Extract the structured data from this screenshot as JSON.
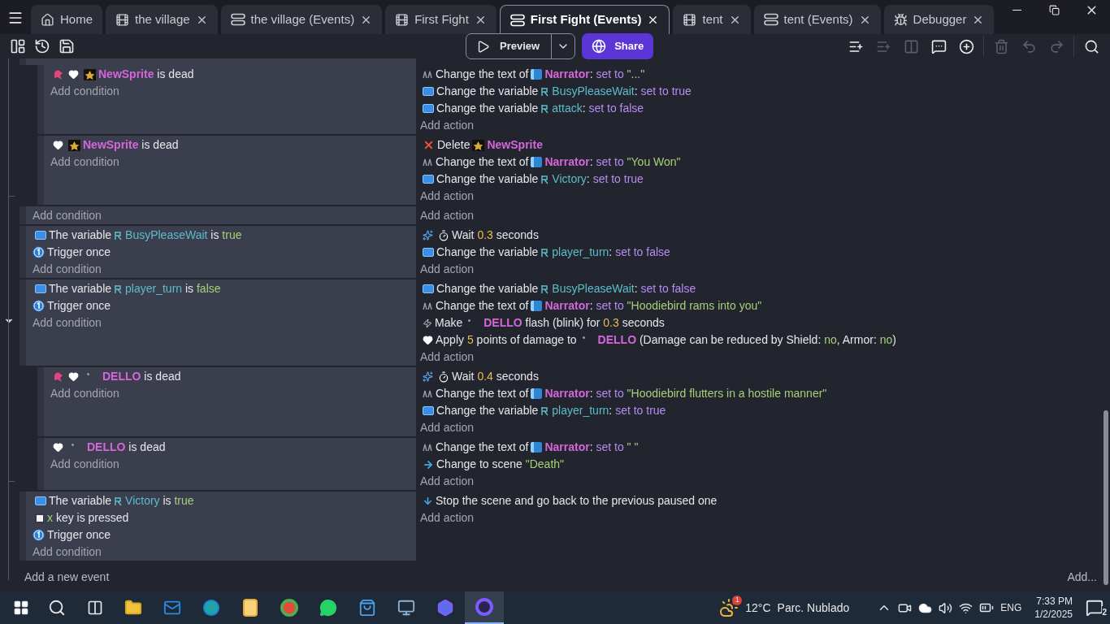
{
  "tabs": [
    {
      "label": "Home",
      "kind": "home",
      "closable": false,
      "selected": false
    },
    {
      "label": "the village",
      "kind": "scene",
      "closable": true,
      "selected": false
    },
    {
      "label": "the village (Events)",
      "kind": "events",
      "closable": true,
      "selected": false
    },
    {
      "label": "First Fight",
      "kind": "scene",
      "closable": true,
      "selected": false
    },
    {
      "label": "First Fight (Events)",
      "kind": "events",
      "closable": true,
      "selected": true
    },
    {
      "label": "tent",
      "kind": "scene",
      "closable": true,
      "selected": false
    },
    {
      "label": "tent (Events)",
      "kind": "events",
      "closable": true,
      "selected": false
    },
    {
      "label": "Debugger",
      "kind": "debugger",
      "closable": true,
      "selected": false
    }
  ],
  "toolbar": {
    "preview": "Preview",
    "share": "Share",
    "tools": [
      {
        "kind": "addevent",
        "disabled": false
      },
      {
        "kind": "addsub",
        "disabled": true
      },
      {
        "kind": "addelse",
        "disabled": true
      },
      {
        "kind": "comment",
        "disabled": false
      },
      {
        "kind": "add",
        "disabled": false
      },
      {
        "kind": "delete",
        "disabled": true
      },
      {
        "kind": "undo",
        "disabled": true
      },
      {
        "kind": "redo",
        "disabled": true
      },
      {
        "kind": "search",
        "disabled": false
      }
    ]
  },
  "events": [
    {
      "clipped": true,
      "hovered": false,
      "children": [
        {
          "clipped": false,
          "hovered": false,
          "add_condition": "Add condition",
          "add_action": "Add action",
          "conditions": [
            [
              {
                "kind": "potion"
              },
              {
                "kind": "heart"
              },
              {
                "kind": "sprite"
              },
              {
                "text": "NewSprite",
                "kind": "object"
              },
              {
                "text": " is dead",
                "kind": "plain"
              }
            ]
          ],
          "actions": [
            [
              {
                "kind": "textaction"
              },
              {
                "text": "Change the text of",
                "kind": "plain"
              },
              {
                "kind": "textobj"
              },
              {
                "text": "Narrator",
                "kind": "object"
              },
              {
                "text": ": ",
                "kind": "plain"
              },
              {
                "text": "set to ",
                "kind": "value"
              },
              {
                "text": "\"...\"",
                "kind": "string"
              }
            ],
            [
              {
                "kind": "var"
              },
              {
                "text": "Change the variable",
                "kind": "plain"
              },
              {
                "kind": "varref"
              },
              {
                "text": "BusyPleaseWait",
                "kind": "variable"
              },
              {
                "text": ": ",
                "kind": "plain"
              },
              {
                "text": "set to true",
                "kind": "value"
              }
            ],
            [
              {
                "kind": "var"
              },
              {
                "text": "Change the variable",
                "kind": "plain"
              },
              {
                "kind": "varref"
              },
              {
                "text": "attack",
                "kind": "variable"
              },
              {
                "text": ": ",
                "kind": "plain"
              },
              {
                "text": "set to false",
                "kind": "value"
              }
            ]
          ]
        },
        {
          "clipped": false,
          "hovered": false,
          "add_condition": "Add condition",
          "add_action": "Add action",
          "conditions": [
            [
              {
                "kind": "heart"
              },
              {
                "kind": "sprite"
              },
              {
                "text": "NewSprite",
                "kind": "object"
              },
              {
                "text": " is dead",
                "kind": "plain"
              }
            ]
          ],
          "actions": [
            [
              {
                "kind": "delete"
              },
              {
                "text": "Delete",
                "kind": "plain"
              },
              {
                "kind": "sprite"
              },
              {
                "text": "NewSprite",
                "kind": "object"
              }
            ],
            [
              {
                "kind": "textaction"
              },
              {
                "text": "Change the text of",
                "kind": "plain"
              },
              {
                "kind": "textobj"
              },
              {
                "text": "Narrator",
                "kind": "object"
              },
              {
                "text": ": ",
                "kind": "plain"
              },
              {
                "text": "set to ",
                "kind": "value"
              },
              {
                "text": "\"You Won\"",
                "kind": "string"
              }
            ],
            [
              {
                "kind": "var"
              },
              {
                "text": "Change the variable",
                "kind": "plain"
              },
              {
                "kind": "varref"
              },
              {
                "text": "Victory",
                "kind": "variable"
              },
              {
                "text": ": ",
                "kind": "plain"
              },
              {
                "text": "set to true",
                "kind": "value"
              }
            ]
          ]
        }
      ]
    },
    {
      "clipped": false,
      "hovered": false,
      "add_condition": "Add condition",
      "add_action": "Add action"
    },
    {
      "clipped": false,
      "hovered": false,
      "add_condition": "Add condition",
      "add_action": "Add action",
      "conditions": [
        [
          {
            "kind": "var"
          },
          {
            "text": "The variable",
            "kind": "plain"
          },
          {
            "kind": "varref"
          },
          {
            "text": "BusyPleaseWait",
            "kind": "variable"
          },
          {
            "text": " is ",
            "kind": "plain"
          },
          {
            "text": "true",
            "kind": "bool"
          }
        ],
        [
          {
            "kind": "trigger"
          },
          {
            "text": "Trigger once",
            "kind": "plain"
          }
        ]
      ],
      "actions": [
        [
          {
            "kind": "wait"
          },
          {
            "kind": "timer"
          },
          {
            "text": "Wait ",
            "kind": "plain"
          },
          {
            "text": "0.3",
            "kind": "number"
          },
          {
            "text": " seconds",
            "kind": "plain"
          }
        ],
        [
          {
            "kind": "var"
          },
          {
            "text": "Change the variable",
            "kind": "plain"
          },
          {
            "kind": "varref"
          },
          {
            "text": "player_turn",
            "kind": "variable"
          },
          {
            "text": ": ",
            "kind": "plain"
          },
          {
            "text": "set to false",
            "kind": "value"
          }
        ]
      ]
    },
    {
      "clipped": false,
      "hovered": true,
      "add_condition": "Add condition",
      "add_action": "Add action",
      "conditions": [
        [
          {
            "kind": "var"
          },
          {
            "text": "The variable",
            "kind": "plain"
          },
          {
            "kind": "varref"
          },
          {
            "text": "player_turn",
            "kind": "variable"
          },
          {
            "text": " is ",
            "kind": "plain"
          },
          {
            "text": "false",
            "kind": "bool"
          }
        ],
        [
          {
            "kind": "trigger"
          },
          {
            "text": "Trigger once",
            "kind": "plain"
          }
        ]
      ],
      "actions": [
        [
          {
            "kind": "var"
          },
          {
            "text": "Change the variable",
            "kind": "plain"
          },
          {
            "kind": "varref"
          },
          {
            "text": "BusyPleaseWait",
            "kind": "variable"
          },
          {
            "text": ": ",
            "kind": "plain"
          },
          {
            "text": "set to false",
            "kind": "value"
          }
        ],
        [
          {
            "kind": "textaction"
          },
          {
            "text": "Change the text of",
            "kind": "plain"
          },
          {
            "kind": "textobj"
          },
          {
            "text": "Narrator",
            "kind": "object"
          },
          {
            "text": ": ",
            "kind": "plain"
          },
          {
            "text": "set to ",
            "kind": "value"
          },
          {
            "text": "\"Hoodiebird rams into you\"",
            "kind": "string"
          }
        ],
        [
          {
            "kind": "flash"
          },
          {
            "text": "Make",
            "kind": "plain"
          },
          {
            "kind": "dot"
          },
          {
            "text": "DELLO",
            "kind": "object"
          },
          {
            "text": " flash (blink) for ",
            "kind": "plain"
          },
          {
            "text": "0.3",
            "kind": "number"
          },
          {
            "text": " seconds",
            "kind": "plain"
          }
        ],
        [
          {
            "kind": "heart"
          },
          {
            "text": "Apply ",
            "kind": "plain"
          },
          {
            "text": "5",
            "kind": "number"
          },
          {
            "text": " points of damage to",
            "kind": "plain"
          },
          {
            "kind": "dot"
          },
          {
            "text": "DELLO",
            "kind": "object"
          },
          {
            "text": " (Damage can be reduced by Shield: ",
            "kind": "plain"
          },
          {
            "text": "no",
            "kind": "bool"
          },
          {
            "text": ", Armor: ",
            "kind": "plain"
          },
          {
            "text": "no",
            "kind": "bool"
          },
          {
            "text": ")",
            "kind": "plain"
          }
        ]
      ],
      "children": [
        {
          "clipped": false,
          "hovered": false,
          "add_condition": "Add condition",
          "add_action": "Add action",
          "conditions": [
            [
              {
                "kind": "potion"
              },
              {
                "kind": "heart"
              },
              {
                "kind": "dot"
              },
              {
                "text": "DELLO",
                "kind": "object"
              },
              {
                "text": " is dead",
                "kind": "plain"
              }
            ]
          ],
          "actions": [
            [
              {
                "kind": "wait"
              },
              {
                "kind": "timer"
              },
              {
                "text": "Wait ",
                "kind": "plain"
              },
              {
                "text": "0.4",
                "kind": "number"
              },
              {
                "text": " seconds",
                "kind": "plain"
              }
            ],
            [
              {
                "kind": "textaction"
              },
              {
                "text": "Change the text of",
                "kind": "plain"
              },
              {
                "kind": "textobj"
              },
              {
                "text": "Narrator",
                "kind": "object"
              },
              {
                "text": ": ",
                "kind": "plain"
              },
              {
                "text": "set to ",
                "kind": "value"
              },
              {
                "text": "\"Hoodiebird flutters in a hostile manner\"",
                "kind": "string"
              }
            ],
            [
              {
                "kind": "var"
              },
              {
                "text": "Change the variable",
                "kind": "plain"
              },
              {
                "kind": "varref"
              },
              {
                "text": "player_turn",
                "kind": "variable"
              },
              {
                "text": ": ",
                "kind": "plain"
              },
              {
                "text": "set to true",
                "kind": "value"
              }
            ]
          ]
        },
        {
          "clipped": false,
          "hovered": false,
          "add_condition": "Add condition",
          "add_action": "Add action",
          "conditions": [
            [
              {
                "kind": "heart"
              },
              {
                "kind": "dot"
              },
              {
                "text": "DELLO",
                "kind": "object"
              },
              {
                "text": " is dead",
                "kind": "plain"
              }
            ]
          ],
          "actions": [
            [
              {
                "kind": "textaction"
              },
              {
                "text": "Change the text of",
                "kind": "plain"
              },
              {
                "kind": "textobj"
              },
              {
                "text": "Narrator",
                "kind": "object"
              },
              {
                "text": ": ",
                "kind": "plain"
              },
              {
                "text": "set to ",
                "kind": "value"
              },
              {
                "text": "\" \"",
                "kind": "string"
              }
            ],
            [
              {
                "kind": "scene"
              },
              {
                "text": "Change to scene ",
                "kind": "plain"
              },
              {
                "text": "\"Death\"",
                "kind": "string"
              }
            ]
          ]
        }
      ]
    },
    {
      "clipped": false,
      "hovered": false,
      "add_condition": "Add condition",
      "add_action": "Add action",
      "conditions": [
        [
          {
            "kind": "var"
          },
          {
            "text": "The variable",
            "kind": "plain"
          },
          {
            "kind": "varref"
          },
          {
            "text": "Victory",
            "kind": "variable"
          },
          {
            "text": " is ",
            "kind": "plain"
          },
          {
            "text": "true",
            "kind": "bool"
          }
        ],
        [
          {
            "kind": "key"
          },
          {
            "text": "x",
            "kind": "bool"
          },
          {
            "text": " key is pressed",
            "kind": "plain"
          }
        ],
        [
          {
            "kind": "trigger"
          },
          {
            "text": "Trigger once",
            "kind": "plain"
          }
        ]
      ],
      "actions": [
        [
          {
            "kind": "stop"
          },
          {
            "text": "Stop the scene and go back to the previous paused one",
            "kind": "plain"
          }
        ]
      ]
    }
  ],
  "footer": {
    "add_event": "Add a new event",
    "add_more": "Add..."
  },
  "taskbar": {
    "apps": [
      {
        "kind": "folder",
        "selected": false
      },
      {
        "kind": "mail",
        "selected": false
      },
      {
        "kind": "browser",
        "selected": false
      },
      {
        "kind": "document",
        "selected": false
      },
      {
        "kind": "chrome",
        "selected": false
      },
      {
        "kind": "chat",
        "selected": false
      },
      {
        "kind": "store",
        "selected": false
      },
      {
        "kind": "monitor",
        "selected": false
      },
      {
        "kind": "assistant",
        "selected": false
      },
      {
        "kind": "gdevelop",
        "selected": true
      }
    ],
    "weather_badge": "1",
    "temperature": "12°C",
    "weather": "Parc. Nublado",
    "language": "ENG",
    "time": "7:33 PM",
    "date": "1/2/2025",
    "notifications": "2"
  }
}
